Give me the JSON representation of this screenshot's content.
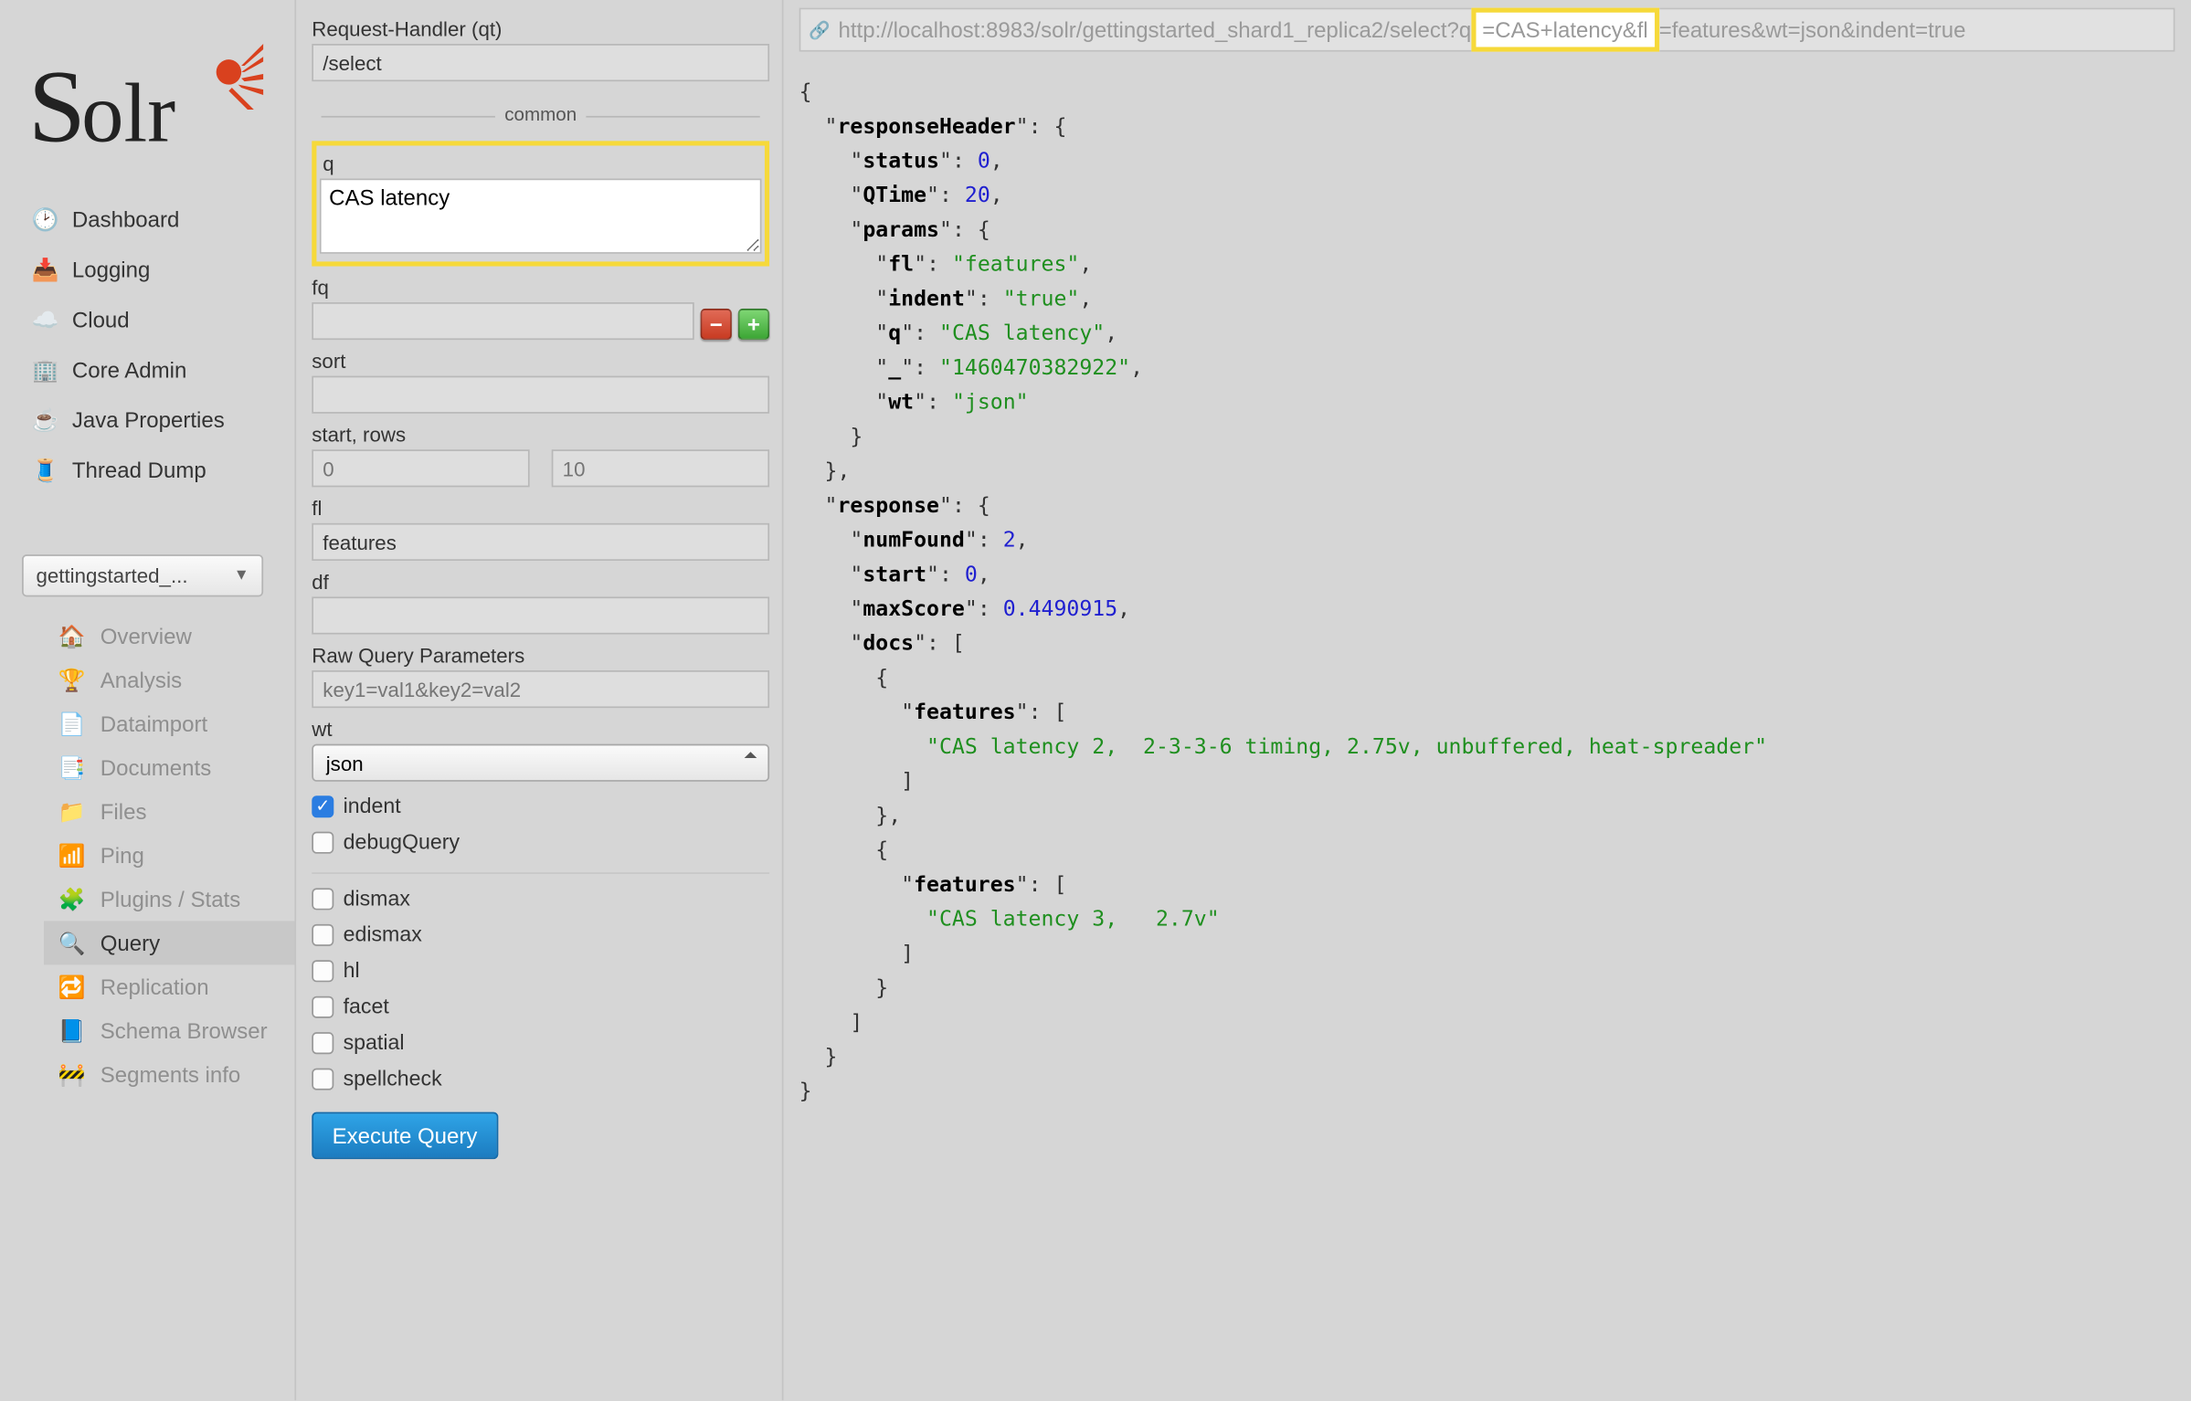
{
  "logo_text": "Solr",
  "nav": [
    {
      "label": "Dashboard"
    },
    {
      "label": "Logging"
    },
    {
      "label": "Cloud"
    },
    {
      "label": "Core Admin"
    },
    {
      "label": "Java Properties"
    },
    {
      "label": "Thread Dump"
    }
  ],
  "core_selector": "gettingstarted_...",
  "subnav": [
    {
      "label": "Overview"
    },
    {
      "label": "Analysis"
    },
    {
      "label": "Dataimport"
    },
    {
      "label": "Documents"
    },
    {
      "label": "Files"
    },
    {
      "label": "Ping"
    },
    {
      "label": "Plugins / Stats"
    },
    {
      "label": "Query"
    },
    {
      "label": "Replication"
    },
    {
      "label": "Schema Browser"
    },
    {
      "label": "Segments info"
    }
  ],
  "subnav_active": "Query",
  "form": {
    "request_handler_label": "Request-Handler (qt)",
    "request_handler_value": "/select",
    "common_label": "common",
    "q_label": "q",
    "q_value": "CAS latency",
    "fq_label": "fq",
    "fq_value": "",
    "sort_label": "sort",
    "sort_value": "",
    "start_rows_label": "start, rows",
    "start_placeholder": "0",
    "rows_placeholder": "10",
    "fl_label": "fl",
    "fl_value": "features",
    "df_label": "df",
    "df_value": "",
    "raw_label": "Raw Query Parameters",
    "raw_placeholder": "key1=val1&key2=val2",
    "wt_label": "wt",
    "wt_value": "json",
    "indent_label": "indent",
    "debug_label": "debugQuery",
    "dismax_label": "dismax",
    "edismax_label": "edismax",
    "hl_label": "hl",
    "facet_label": "facet",
    "spatial_label": "spatial",
    "spellcheck_label": "spellcheck",
    "execute_label": "Execute Query"
  },
  "url": {
    "pre": "http://localhost:8983/solr/gettingstarted_shard1_replica2/select?q",
    "hl": "=CAS+latency&fl",
    "post": "=features&wt=json&indent=true"
  },
  "json": {
    "responseHeader_key": "responseHeader",
    "status_key": "status",
    "status_val": "0",
    "qtime_key": "QTime",
    "qtime_val": "20",
    "params_key": "params",
    "fl_key": "fl",
    "fl_val": "\"features\"",
    "indent_key": "indent",
    "indent_val": "\"true\"",
    "q_key": "q",
    "q_val": "\"CAS latency\"",
    "us_key": "_",
    "us_val": "\"1460470382922\"",
    "wt_key": "wt",
    "wt_val": "\"json\"",
    "response_key": "response",
    "numFound_key": "numFound",
    "numFound_val": "2",
    "start_key": "start",
    "start_val": "0",
    "maxScore_key": "maxScore",
    "maxScore_val": "0.4490915",
    "docs_key": "docs",
    "features_key": "features",
    "feat1": "\"CAS latency 2,  2-3-3-6 timing, 2.75v, unbuffered, heat-spreader\"",
    "feat2": "\"CAS latency 3,   2.7v\""
  }
}
